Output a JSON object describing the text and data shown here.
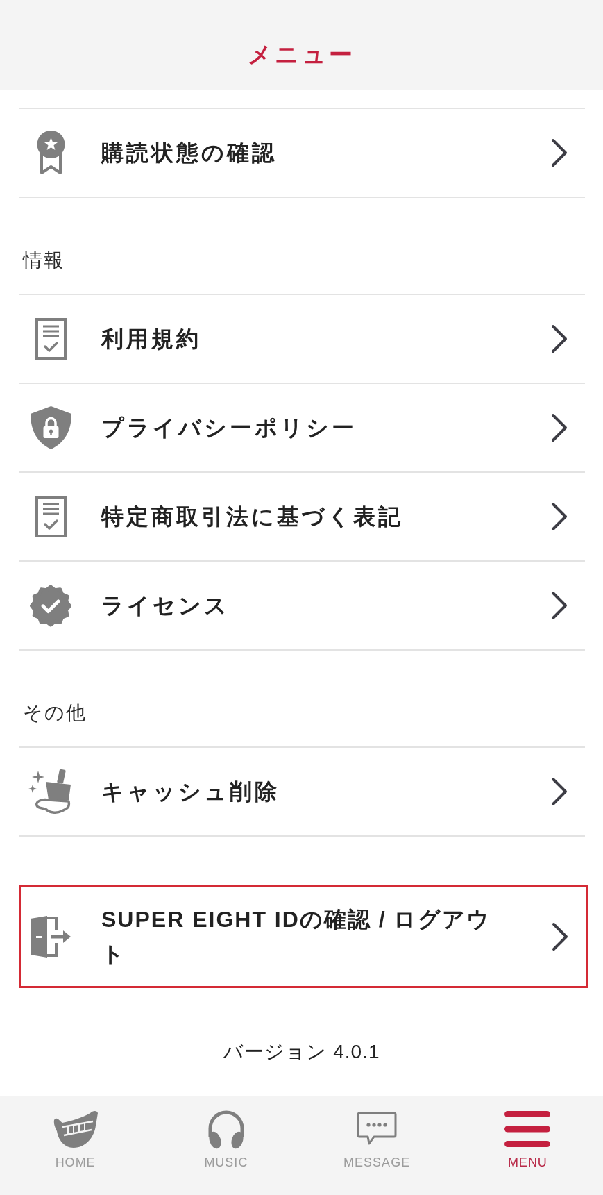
{
  "header": {
    "title": "メニュー"
  },
  "sections": [
    {
      "items": [
        {
          "kind": "subscription",
          "label": "購読状態の確認"
        }
      ]
    },
    {
      "heading": "情報",
      "items": [
        {
          "kind": "document",
          "label": "利用規約"
        },
        {
          "kind": "privacy",
          "label": "プライバシーポリシー"
        },
        {
          "kind": "document",
          "label": "特定商取引法に基づく表記"
        },
        {
          "kind": "license",
          "label": "ライセンス"
        }
      ]
    },
    {
      "heading": "その他",
      "items": [
        {
          "kind": "cache",
          "label": "キャッシュ削除"
        }
      ]
    }
  ],
  "account": {
    "label": "SUPER EIGHT IDの確認 / ログアウト",
    "highlighted": true
  },
  "version": "バージョン 4.0.1",
  "tab_bar": [
    {
      "kind": "home",
      "label": "HOME",
      "selected": false
    },
    {
      "kind": "music",
      "label": "MUSIC",
      "selected": false
    },
    {
      "kind": "message",
      "label": "MESSAGE",
      "selected": false
    },
    {
      "kind": "menu",
      "label": "MENU",
      "selected": true
    }
  ]
}
